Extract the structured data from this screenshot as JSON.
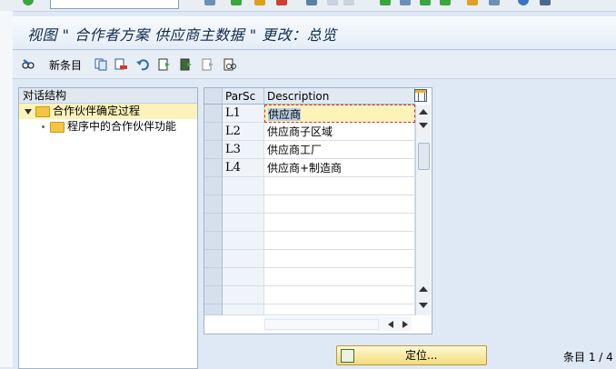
{
  "title": "视图 \" 合作者方案 供应商主数据 \" 更改：总览",
  "toolbar": {
    "new_entries_label": "新条目"
  },
  "tree": {
    "header": "对话结构",
    "items": [
      {
        "label": "合作伙伴确定过程",
        "selected": true,
        "expanded": true
      },
      {
        "label": "程序中的合作伙伴功能",
        "selected": false
      }
    ]
  },
  "table": {
    "columns": [
      "ParSc",
      "Description"
    ],
    "rows": [
      {
        "key": "L1",
        "desc": "供应商"
      },
      {
        "key": "L2",
        "desc": "供应商子区域"
      },
      {
        "key": "L3",
        "desc": "供应商工厂"
      },
      {
        "key": "L4",
        "desc": "供应商+制造商"
      }
    ],
    "empty_rows": 8
  },
  "bottom": {
    "locate_label": "定位...",
    "entry_status": "条目 1 / 4"
  }
}
